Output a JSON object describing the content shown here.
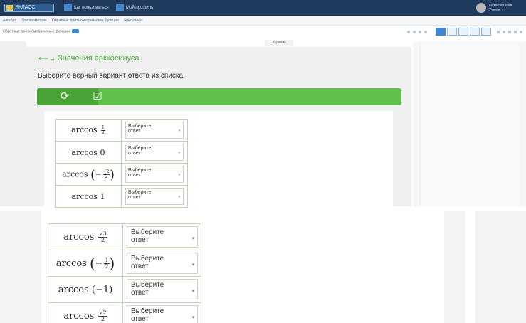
{
  "topbar": {
    "logo_text": "ЯКЛАСС",
    "nav": [
      "Как пользоваться",
      "Мой профиль"
    ],
    "user": [
      "Фамилия Имя",
      "Ученик"
    ]
  },
  "breadcrumbs": [
    "Алгебра",
    "Тригонометрия",
    "Обратные тригонометрические функции",
    "Арккосинус"
  ],
  "toolbar": {
    "path_text": "Обратные тригонометрические функции"
  },
  "tab_label": "Задание",
  "task": {
    "title": "Значения арккосинуса",
    "instruction": "Выберите верный вариант ответа из списка.",
    "toolbar_icons": [
      "refresh-icon",
      "check-icon"
    ]
  },
  "dropdown": {
    "placeholder_line1": "Выберите",
    "placeholder_line2": "ответ"
  },
  "upper_rows": [
    {
      "func": "arccos",
      "type": "frac",
      "num": "1",
      "den": "2"
    },
    {
      "func": "arccos",
      "type": "plain",
      "arg": "0"
    },
    {
      "func": "arccos",
      "type": "negfrac",
      "num": "√2",
      "den": "2"
    },
    {
      "func": "arccos",
      "type": "plain",
      "arg": "1"
    }
  ],
  "lower_rows": [
    {
      "func": "arccos",
      "type": "frac",
      "num": "√3",
      "den": "2"
    },
    {
      "func": "arccos",
      "type": "negfrac",
      "num": "1",
      "den": "2"
    },
    {
      "func": "arccos",
      "type": "paren",
      "arg": "−1"
    },
    {
      "func": "arccos",
      "type": "frac",
      "num": "√2",
      "den": "2"
    }
  ],
  "colors": {
    "accent_green": "#5fbf4a",
    "topbar": "#1f3a5c",
    "link_blue": "#3f88d1"
  }
}
